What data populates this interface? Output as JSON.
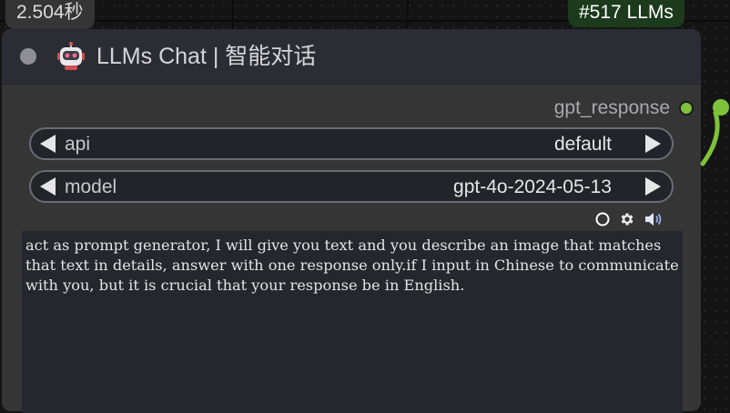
{
  "timer": "2.504秒",
  "badge": "#517 LLMs",
  "node": {
    "title": "LLMs Chat | 智能对话",
    "output": {
      "label": "gpt_response",
      "color": "#7ec23a"
    },
    "widgets": [
      {
        "name": "api",
        "value": "default"
      },
      {
        "name": "model",
        "value": "gpt-4o-2024-05-13"
      }
    ],
    "prompt": "act as prompt generator, I will give you text and you describe an image that matches that text in details, answer with one response only.if I input in Chinese to communicate with you, but it is crucial that your response be in English.",
    "icons": [
      "circle-icon",
      "gear-icon",
      "speaker-icon"
    ]
  }
}
